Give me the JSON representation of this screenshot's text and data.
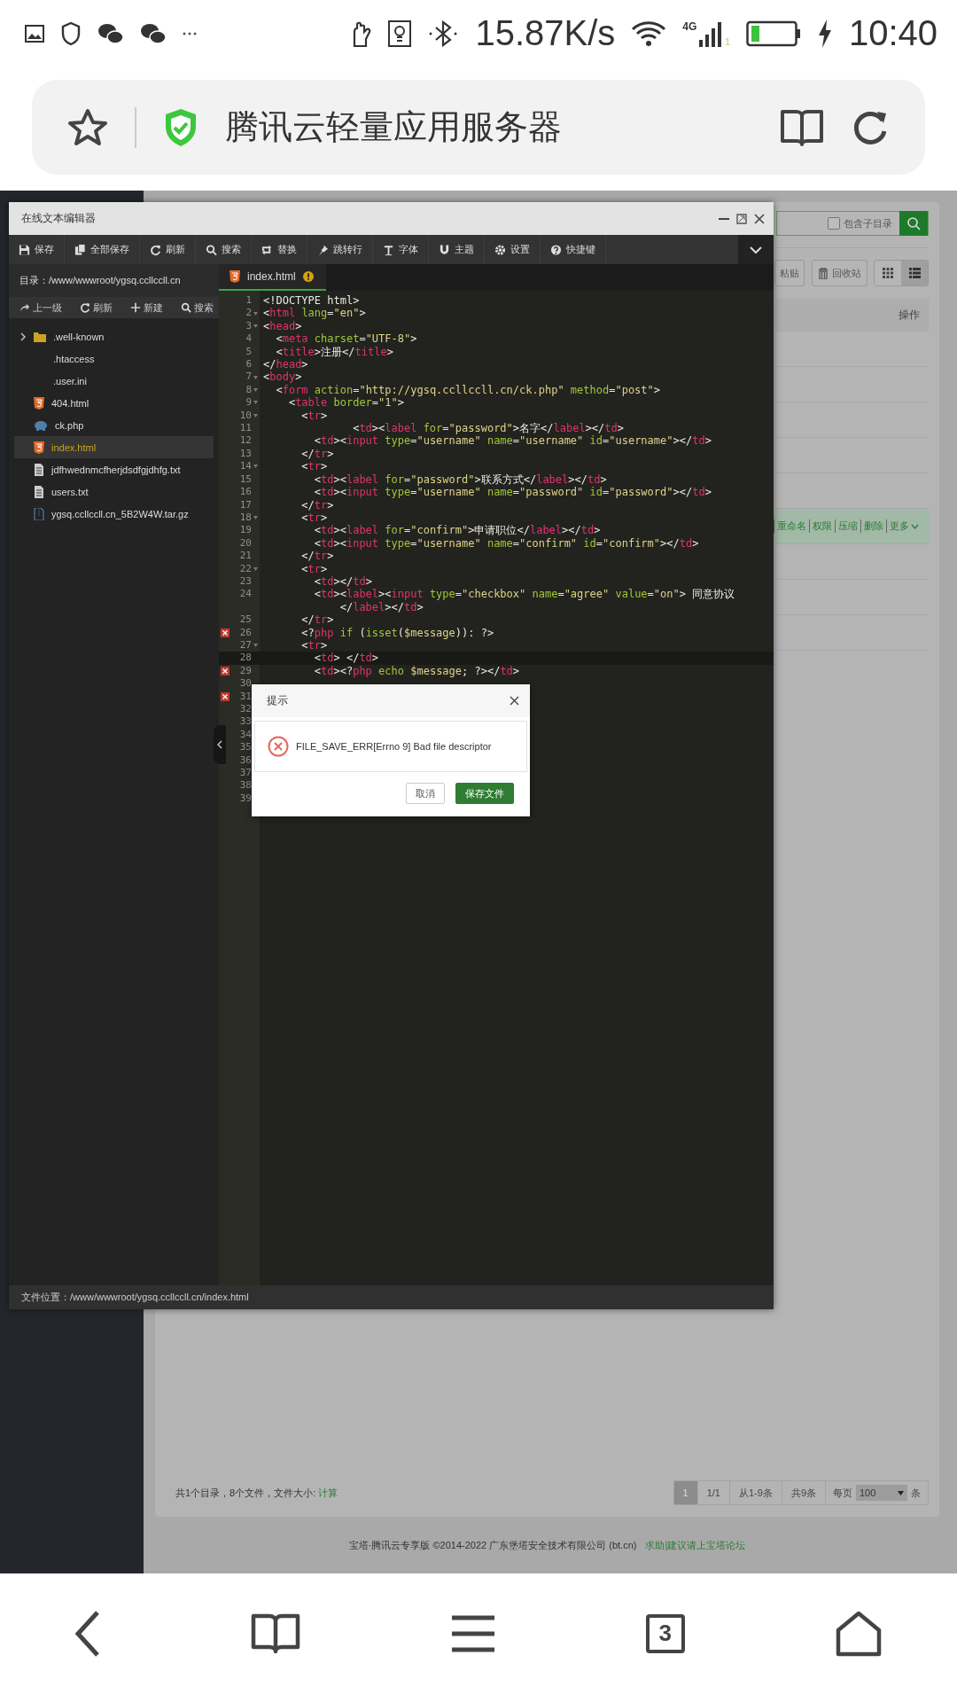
{
  "nav": {
    "tab_count": "3"
  },
  "status_bar": {
    "speed": "15.87K/s",
    "network": "4G",
    "sim": "1",
    "time": "10:40"
  },
  "browser": {
    "page_title": "腾讯云轻量应用服务器"
  },
  "panel": {
    "search": {
      "label": "包含子目录",
      "checked": false
    },
    "toolbar_buttons": [
      "粘贴",
      "回收站"
    ],
    "view_modes": [
      {
        "selected": false
      },
      {
        "selected": true
      }
    ],
    "table": {
      "header": "操作",
      "rows": [
        {
          "selected": false
        },
        {
          "selected": false
        },
        {
          "selected": false
        },
        {
          "selected": false
        },
        {
          "selected": false
        },
        {
          "selected": true,
          "actions": [
            "重命名",
            "权限",
            "压缩",
            "删除",
            "更多"
          ]
        },
        {
          "selected": false
        },
        {
          "selected": false
        },
        {
          "selected": false
        }
      ]
    },
    "summary": {
      "text": "共1个目录，8个文件，文件大小: ",
      "link": "计算"
    },
    "pagination": {
      "pages": [
        {
          "label": "1",
          "selected": true
        }
      ],
      "items": [
        "1/1",
        "从1-9条",
        "共9条"
      ],
      "per_page_label": "每页",
      "per_page": "100",
      "unit": "条"
    }
  },
  "footer": {
    "copyright": "宝塔·腾讯云专享版 ©2014-2022 广东堡塔安全技术有限公司 (bt.cn)",
    "link": "求助|建议请上宝塔论坛"
  },
  "editor": {
    "title": "在线文本编辑器",
    "toolbar": [
      "保存",
      "全部保存",
      "刷新",
      "搜索",
      "替换",
      "跳转行",
      "字体",
      "主题",
      "设置",
      "快捷键"
    ],
    "directory": "目录：/www/wwwroot/ygsq.ccllccll.cn",
    "tree_actions": [
      "上一级",
      "刷新",
      "新建",
      "搜索"
    ],
    "files": [
      {
        "name": ".well-known",
        "kind": "folder",
        "expanded": false,
        "selected": false
      },
      {
        "name": ".htaccess",
        "kind": "plain",
        "selected": false
      },
      {
        "name": ".user.ini",
        "kind": "plain",
        "selected": false
      },
      {
        "name": "404.html",
        "kind": "html",
        "selected": false
      },
      {
        "name": "ck.php",
        "kind": "php",
        "selected": false
      },
      {
        "name": "index.html",
        "kind": "html",
        "selected": true
      },
      {
        "name": "jdfhwednmcfherjdsdfgjdhfg.txt",
        "kind": "text",
        "selected": false
      },
      {
        "name": "users.txt",
        "kind": "text",
        "selected": false
      },
      {
        "name": "ygsq.ccllccll.cn_5B2W4W.tar.gz",
        "kind": "archive",
        "selected": false
      }
    ],
    "tabs": [
      {
        "label": "index.html",
        "selected": true,
        "modified": true
      }
    ],
    "lines": [
      {
        "number": "1",
        "code": "<!DOCTYPE html>",
        "fold": false,
        "error": false,
        "current": false
      },
      {
        "number": "2",
        "code": "<html lang=\"en\">",
        "fold": true,
        "error": false,
        "current": false
      },
      {
        "number": "3",
        "code": "<head>",
        "fold": true,
        "error": false,
        "current": false
      },
      {
        "number": "4",
        "code": "  <meta charset=\"UTF-8\">",
        "fold": false,
        "error": false,
        "current": false
      },
      {
        "number": "5",
        "code": "  <title>注册</title>",
        "fold": false,
        "error": false,
        "current": false
      },
      {
        "number": "6",
        "code": "</head>",
        "fold": false,
        "error": false,
        "current": false
      },
      {
        "number": "7",
        "code": "<body>",
        "fold": true,
        "error": false,
        "current": false
      },
      {
        "number": "8",
        "code": "  <form action=\"http://ygsq.ccllccll.cn/ck.php\" method=\"post\">",
        "fold": true,
        "error": false,
        "current": false
      },
      {
        "number": "9",
        "code": "    <table border=\"1\">",
        "fold": true,
        "error": false,
        "current": false
      },
      {
        "number": "10",
        "code": "      <tr>",
        "fold": true,
        "error": false,
        "current": false
      },
      {
        "number": "11",
        "code": "              <td><label for=\"password\">名字</label></td>",
        "fold": false,
        "error": false,
        "current": false
      },
      {
        "number": "12",
        "code": "        <td><input type=\"username\" name=\"username\" id=\"username\"></td>",
        "fold": false,
        "error": false,
        "current": false
      },
      {
        "number": "13",
        "code": "      </tr>",
        "fold": false,
        "error": false,
        "current": false
      },
      {
        "number": "14",
        "code": "      <tr>",
        "fold": true,
        "error": false,
        "current": false
      },
      {
        "number": "15",
        "code": "        <td><label for=\"password\">联系方式</label></td>",
        "fold": false,
        "error": false,
        "current": false
      },
      {
        "number": "16",
        "code": "        <td><input type=\"username\" name=\"password\" id=\"password\"></td>",
        "fold": false,
        "error": false,
        "current": false
      },
      {
        "number": "17",
        "code": "      </tr>",
        "fold": false,
        "error": false,
        "current": false
      },
      {
        "number": "18",
        "code": "      <tr>",
        "fold": true,
        "error": false,
        "current": false
      },
      {
        "number": "19",
        "code": "        <td><label for=\"confirm\">申请职位</label></td>",
        "fold": false,
        "error": false,
        "current": false
      },
      {
        "number": "20",
        "code": "        <td><input type=\"username\" name=\"confirm\" id=\"confirm\"></td>",
        "fold": false,
        "error": false,
        "current": false
      },
      {
        "number": "21",
        "code": "      </tr>",
        "fold": false,
        "error": false,
        "current": false
      },
      {
        "number": "22",
        "code": "      <tr>",
        "fold": true,
        "error": false,
        "current": false
      },
      {
        "number": "23",
        "code": "        <td></td>",
        "fold": false,
        "error": false,
        "current": false
      },
      {
        "number": "24",
        "code": "        <td><label><input type=\"checkbox\" name=\"agree\" value=\"on\"> 同意协议",
        "continuation": "            </label></td>",
        "fold": false,
        "error": false,
        "current": false
      },
      {
        "number": "25",
        "code": "      </tr>",
        "fold": false,
        "error": false,
        "current": false
      },
      {
        "number": "26",
        "code": "      <?php if (isset($message)): ?>",
        "fold": false,
        "error": true,
        "current": false
      },
      {
        "number": "27",
        "code": "      <tr>",
        "fold": true,
        "error": false,
        "current": false
      },
      {
        "number": "28",
        "code": "        <td> </td>",
        "fold": false,
        "error": false,
        "current": true
      },
      {
        "number": "29",
        "code": "        <td><?php echo $message; ?></td>",
        "fold": false,
        "error": true,
        "current": false
      },
      {
        "number": "30",
        "fold": false,
        "error": false,
        "current": false
      },
      {
        "number": "31",
        "fold": false,
        "error": true,
        "current": false
      },
      {
        "number": "32",
        "fold": false,
        "error": false,
        "current": false
      },
      {
        "number": "33",
        "fold": false,
        "error": false,
        "current": false
      },
      {
        "number": "34",
        "fold": false,
        "error": false,
        "current": false
      },
      {
        "number": "35",
        "fold": false,
        "error": false,
        "current": false
      },
      {
        "number": "36",
        "fold": false,
        "error": false,
        "current": false
      },
      {
        "number": "37",
        "fold": false,
        "error": false,
        "current": false
      },
      {
        "number": "38",
        "fold": false,
        "error": false,
        "current": false
      },
      {
        "number": "39",
        "fold": false,
        "error": false,
        "current": false
      }
    ],
    "file_path": "文件位置：/www/wwwroot/ygsq.ccllccll.cn/index.html"
  },
  "dialog": {
    "title": "提示",
    "message": "FILE_SAVE_ERR[Errno 9] Bad file descriptor",
    "buttons": [
      {
        "label": "取消",
        "kind": "default"
      },
      {
        "label": "保存文件",
        "kind": "primary"
      }
    ]
  }
}
